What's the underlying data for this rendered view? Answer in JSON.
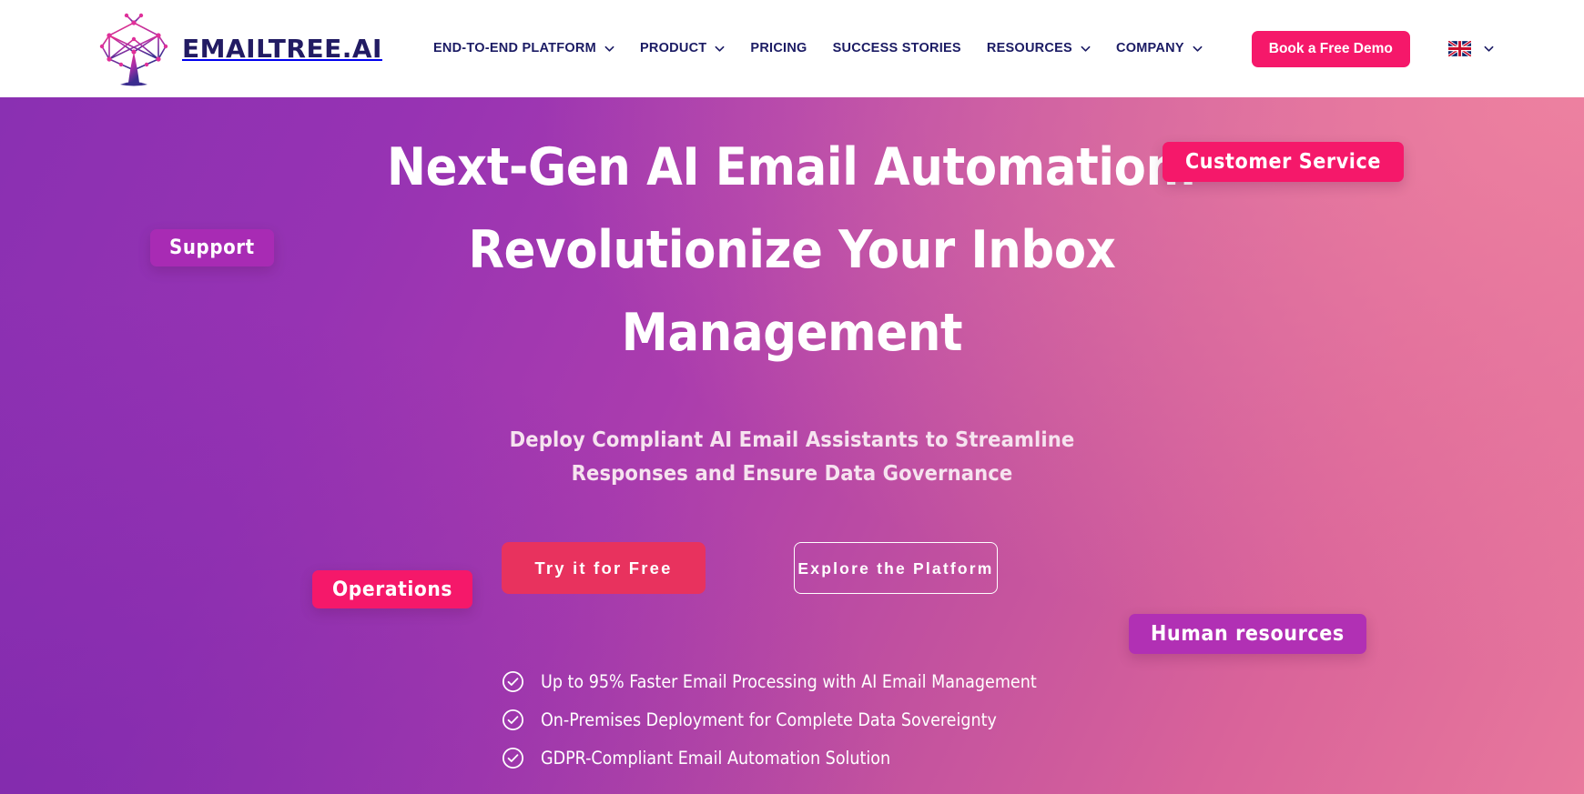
{
  "header": {
    "logo": {
      "icon": "emailtree-network-tree-logo",
      "text": "EMAILTREE.AI"
    },
    "nav": [
      {
        "label": "END-TO-END PLATFORM",
        "has_dropdown": true,
        "icon": "chevron-down-icon"
      },
      {
        "label": "PRODUCT",
        "has_dropdown": true,
        "icon": "chevron-down-icon"
      },
      {
        "label": "PRICING",
        "has_dropdown": false,
        "icon": ""
      },
      {
        "label": "SUCCESS STORIES",
        "has_dropdown": false,
        "icon": ""
      },
      {
        "label": "RESOURCES",
        "has_dropdown": true,
        "icon": "chevron-down-icon"
      },
      {
        "label": "COMPANY",
        "has_dropdown": true,
        "icon": "chevron-down-icon"
      }
    ],
    "cta_label": "Book a Free Demo",
    "language": {
      "flag": "uk-flag-icon",
      "code": "EN",
      "icon": "chevron-down-icon"
    }
  },
  "hero": {
    "headline": "Next-Gen AI Email Automation: Revolutionize Your Inbox Management",
    "subheadline": "Deploy Compliant AI Email Assistants to Streamline Responses and Ensure Data Governance",
    "primary_cta": "Try it for Free",
    "secondary_cta": "Explore the Platform",
    "badges": [
      {
        "label": "Support",
        "color": "#a82bb4"
      },
      {
        "label": "Customer Service",
        "color": "#f5186a"
      },
      {
        "label": "Operations",
        "color": "#f5186a"
      },
      {
        "label": "Human resources",
        "color": "#b130b4"
      }
    ],
    "features": [
      {
        "icon": "check-circle-icon",
        "text": "Up to 95% Faster Email Processing with AI Email Management"
      },
      {
        "icon": "check-circle-icon",
        "text": "On-Premises Deployment for Complete Data Sovereignty"
      },
      {
        "icon": "check-circle-icon",
        "text": "GDPR-Compliant Email Automation Solution"
      }
    ]
  },
  "colors": {
    "brand_navy": "#1b1b64",
    "brand_pink": "#f5186a",
    "cta_red": "#e8325e",
    "gradient_start": "#8a30b2",
    "gradient_end": "#e8789c"
  }
}
